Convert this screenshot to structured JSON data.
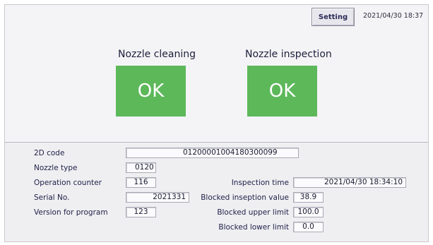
{
  "header": {
    "setting_label": "Setting",
    "datetime": "2021/04/30 18:37"
  },
  "checks": {
    "cleaning": {
      "label": "Nozzle cleaning",
      "result": "OK"
    },
    "inspection": {
      "label": "Nozzle inspection",
      "result": "OK"
    }
  },
  "info": {
    "code_2d": {
      "label": "2D code",
      "value": "01200001004180300099"
    },
    "nozzle_type": {
      "label": "Nozzle type",
      "value": "0120"
    },
    "operation_counter": {
      "label": "Operation counter",
      "value": "116"
    },
    "serial_no": {
      "label": "Serial No.",
      "value": "2021331"
    },
    "version": {
      "label": "Version for program",
      "value": "123"
    },
    "inspection_time": {
      "label": "Inspection time",
      "value": "2021/04/30 18:34:10"
    },
    "blocked_value": {
      "label": "Blocked inseption value",
      "value": "38.9"
    },
    "blocked_upper": {
      "label": "Blocked upper limit",
      "value": "100.0"
    },
    "blocked_lower": {
      "label": "Blocked lower limit",
      "value": "0.0"
    }
  },
  "colors": {
    "ok_green": "#5db85a",
    "background": "#f4f4f6",
    "label_text": "#22224a"
  }
}
